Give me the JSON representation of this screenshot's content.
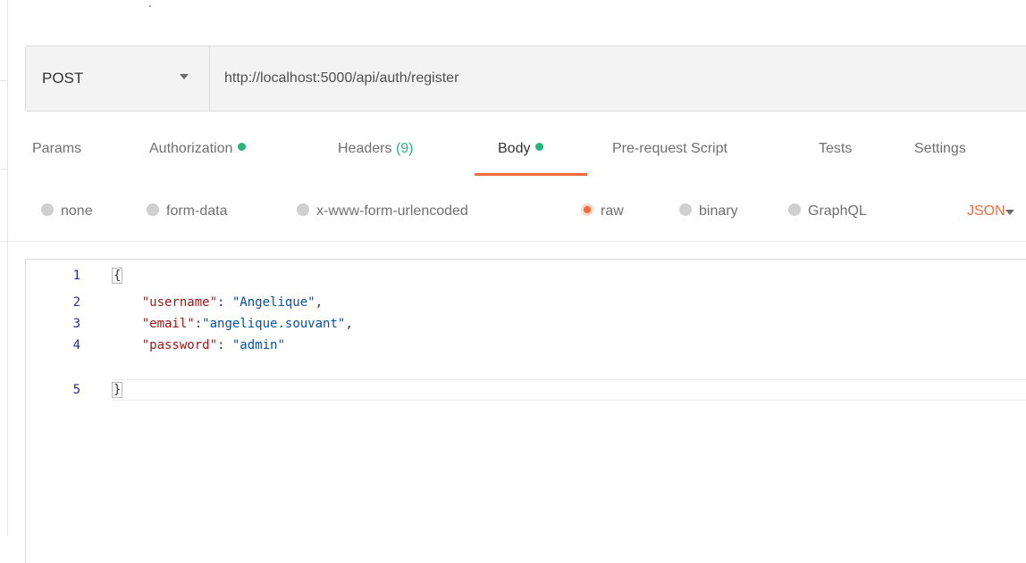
{
  "request": {
    "method": "POST",
    "url": "http://localhost:5000/api/auth/register"
  },
  "tabs": [
    {
      "label": "Params"
    },
    {
      "label": "Authorization"
    },
    {
      "label": "Headers",
      "count": "(9)"
    },
    {
      "label": "Body"
    },
    {
      "label": "Pre-request Script"
    },
    {
      "label": "Tests"
    },
    {
      "label": "Settings"
    }
  ],
  "active_tab": "Body",
  "body_modes": [
    {
      "label": "none",
      "selected": false
    },
    {
      "label": "form-data",
      "selected": false
    },
    {
      "label": "x-www-form-urlencoded",
      "selected": false
    },
    {
      "label": "raw",
      "selected": true
    },
    {
      "label": "binary",
      "selected": false
    },
    {
      "label": "GraphQL",
      "selected": false
    }
  ],
  "format": "JSON",
  "editor": {
    "line_numbers": [
      "1",
      "2",
      "3",
      "4",
      "5"
    ],
    "open_brace": "{",
    "close_brace": "}",
    "fields": [
      {
        "key": "\"username\"",
        "sep": ": ",
        "value": "\"Angelique\"",
        "end": ","
      },
      {
        "key": "\"email\"",
        "sep": ":",
        "value": "\"angelique.souvant\"",
        "end": ","
      },
      {
        "key": "\"password\"",
        "sep": ": ",
        "value": "\"admin\"",
        "end": ""
      }
    ]
  },
  "colors": {
    "accent": "#f26b3a",
    "status_green": "#26b47f",
    "json_key": "#a31515",
    "json_string": "#0451a5"
  }
}
